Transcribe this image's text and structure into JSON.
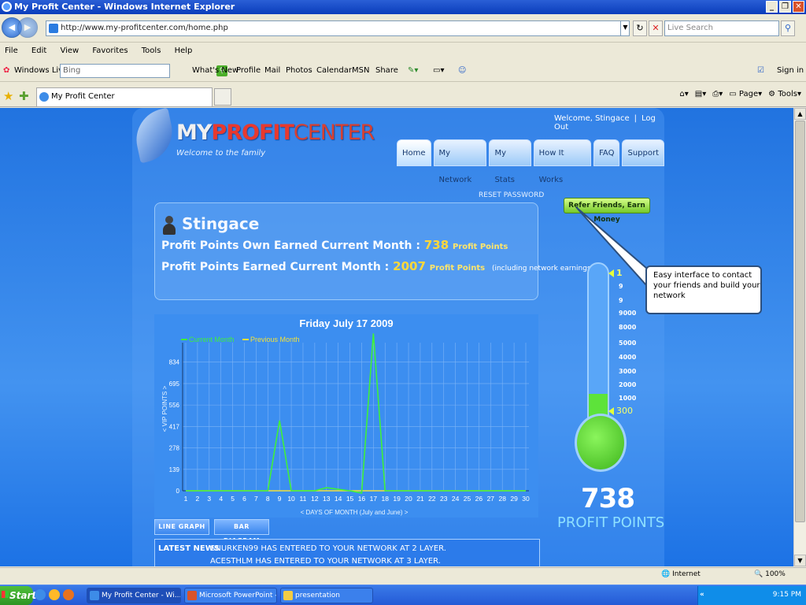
{
  "window": {
    "title": "My Profit Center - Windows Internet Explorer"
  },
  "address": {
    "url": "http://www.my-profitcenter.com/home.php",
    "search_placeholder": "Live Search"
  },
  "menu": [
    "File",
    "Edit",
    "View",
    "Favorites",
    "Tools",
    "Help"
  ],
  "toolbar": {
    "brand": "Windows Live",
    "bing_value": "Bing",
    "links": [
      "What's New",
      "Profile",
      "Mail",
      "Photos",
      "Calendar",
      "MSN",
      "Share"
    ],
    "signin": "Sign in"
  },
  "tab": {
    "title": "My Profit Center"
  },
  "commandbar": {
    "page": "Page",
    "tools": "Tools"
  },
  "site": {
    "logo_a": "MY",
    "logo_b": "PROFIT",
    "logo_c": "CENTER",
    "tagline": "Welcome to the family",
    "welcome": "Welcome, Stingace",
    "logout": "Log Out",
    "nav": [
      "Home",
      "My Network",
      "My Stats",
      "How It Works",
      "FAQ",
      "Support"
    ],
    "reset_password": "RESET PASSWORD",
    "refer_button": "Refer Friends, Earn Money"
  },
  "profile": {
    "username": "Stingace",
    "own_label": "Profit Points Own Earned Current Month :",
    "own_value": "738",
    "own_unit": "Profit Points",
    "earned_label": "Profit Points Earned Current Month :",
    "earned_value": "2007",
    "earned_unit": "Profit Points",
    "earned_note": "(including network earnings)"
  },
  "chart_data": {
    "type": "line",
    "title": "Friday July 17 2009",
    "xlabel": "< DAYS OF MONTH (July and June) >",
    "ylabel": "< VIP POINTS >",
    "x": [
      1,
      2,
      3,
      4,
      5,
      6,
      7,
      8,
      9,
      10,
      11,
      12,
      13,
      14,
      15,
      16,
      17,
      18,
      19,
      20,
      21,
      22,
      23,
      24,
      25,
      26,
      27,
      28,
      29,
      30
    ],
    "yticks": [
      0,
      139,
      278,
      417,
      556,
      695,
      834
    ],
    "ylim": [
      0,
      960
    ],
    "series": [
      {
        "name": "Current Month",
        "color": "#3ff03a",
        "values": [
          0,
          0,
          0,
          0,
          0,
          0,
          0,
          0,
          456,
          0,
          0,
          0,
          20,
          10,
          0,
          -15,
          1020,
          0,
          0,
          0,
          0,
          0,
          0,
          0,
          0,
          0,
          0,
          0,
          0,
          0
        ]
      },
      {
        "name": "Previous Month",
        "color": "#f2e13a",
        "values": [
          0,
          0,
          0,
          0,
          0,
          0,
          0,
          0,
          0,
          0,
          0,
          0,
          0,
          0,
          0,
          0,
          0,
          0,
          0,
          0,
          0,
          0,
          0,
          0,
          0,
          0,
          0,
          0,
          0,
          0
        ]
      }
    ],
    "legend": "top-left",
    "grid": true
  },
  "chart_tabs": [
    "LINE GRAPH",
    "BAR DIAGRAM"
  ],
  "news": {
    "heading": "LATEST NEWS",
    "line1": "SNURKEN99 HAS ENTERED TO YOUR NETWORK AT 2 LAYER.",
    "line2": "ACESTHLM HAS ENTERED TO YOUR NETWORK AT 3 LAYER."
  },
  "thermometer": {
    "scale": [
      "9000",
      "8000",
      "5000",
      "4000",
      "3000",
      "2000",
      "1000"
    ],
    "top_marker": "1",
    "current_marker": "300",
    "fill_fraction": 0.2,
    "big_number": "738",
    "label": "PROFIT POINTS"
  },
  "callout": {
    "text": "Easy interface to contact your friends and build your network"
  },
  "status": {
    "zone": "Internet",
    "zoom": "100%"
  },
  "taskbar": {
    "start": "Start",
    "items": [
      "My Profit Center - Wi...",
      "Microsoft PowerPoint - [...",
      "presentation"
    ],
    "clock": "9:15 PM"
  }
}
